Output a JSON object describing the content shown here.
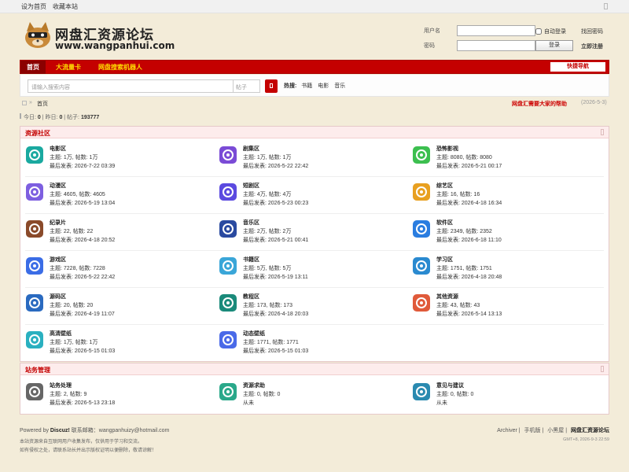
{
  "topbar": {
    "set_home": "设为首页",
    "bookmark": "收藏本站"
  },
  "logo": {
    "title": "网盘汇资源论坛",
    "url": "www.wangpanhui.com"
  },
  "login": {
    "username_label": "用户名",
    "password_label": "密码",
    "auto_login": "自动登录",
    "forgot": "找回密码",
    "login_btn": "登录",
    "register": "立即注册"
  },
  "nav": {
    "items": [
      "首页",
      "大流量卡",
      "网盘搜索机器人"
    ],
    "quick": "快捷导航"
  },
  "search": {
    "placeholder": "请输入搜索内容",
    "scope": "帖子",
    "hot_label": "热搜:",
    "hot": [
      "书籍",
      "电影",
      "音乐"
    ]
  },
  "crumb": {
    "here": "首页",
    "notice": "网盘汇需要大家的帮助",
    "date": "(2026-5-3)"
  },
  "stats": {
    "today_label": "今日:",
    "today": "0",
    "yesterday_label": "昨日:",
    "yesterday": "0",
    "posts_label": "帖子:",
    "posts": "193777"
  },
  "sections": [
    {
      "title": "资源社区",
      "forums": [
        {
          "name": "电影区",
          "stats": "主题: 1万, 帖数: 1万",
          "last": "最后发表: 2026-7-22 03:39",
          "icon": "film-reel-icon",
          "color": "#1aa9a0"
        },
        {
          "name": "剧集区",
          "stats": "主题: 1万, 帖数: 1万",
          "last": "最后发表: 2026-5-22 22:42",
          "icon": "tv-icon",
          "color": "#7a4bd6"
        },
        {
          "name": "恐怖影视",
          "stats": "主题: 8080, 帖数: 8080",
          "last": "最后发表: 2026-5-21 00:17",
          "icon": "ghost-icon",
          "color": "#3cbf4f"
        },
        {
          "name": "动漫区",
          "stats": "主题: 4605, 帖数: 4605",
          "last": "最后发表: 2026-5-19 13:04",
          "icon": "anime-icon",
          "color": "#7d5fe0"
        },
        {
          "name": "短剧区",
          "stats": "主题: 4万, 帖数: 4万",
          "last": "最后发表: 2026-5-23 00:23",
          "icon": "video-play-icon",
          "color": "#5b4ae0"
        },
        {
          "name": "综艺区",
          "stats": "主题: 16, 帖数: 16",
          "last": "最后发表: 2026-4-18 16:34",
          "icon": "variety-icon",
          "color": "#e8a020"
        },
        {
          "name": "纪录片",
          "stats": "主题: 22, 帖数: 22",
          "last": "最后发表: 2026-4-18 20:52",
          "icon": "camera-icon",
          "color": "#8a4a2a"
        },
        {
          "name": "音乐区",
          "stats": "主题: 2万, 帖数: 2万",
          "last": "最后发表: 2026-5-21 00:41",
          "icon": "headphones-icon",
          "color": "#2a4aa0"
        },
        {
          "name": "软件区",
          "stats": "主题: 2349, 帖数: 2352",
          "last": "最后发表: 2026-6-18 11:10",
          "icon": "software-icon",
          "color": "#2a7de0"
        },
        {
          "name": "游戏区",
          "stats": "主题: 7228, 帖数: 7228",
          "last": "最后发表: 2026-5-22 22:42",
          "icon": "gamepad-icon",
          "color": "#3b6de6"
        },
        {
          "name": "书籍区",
          "stats": "主题: 5万, 帖数: 5万",
          "last": "最后发表: 2026-5-19 13:11",
          "icon": "book-icon",
          "color": "#3aa6d8"
        },
        {
          "name": "学习区",
          "stats": "主题: 1751, 帖数: 1751",
          "last": "最后发表: 2026-4-18 20:48",
          "icon": "study-icon",
          "color": "#2a8ad0"
        },
        {
          "name": "源码区",
          "stats": "主题: 20, 帖数: 20",
          "last": "最后发表: 2026-4-19 11:07",
          "icon": "code-icon",
          "color": "#2a6ac0"
        },
        {
          "name": "教程区",
          "stats": "主题: 173, 帖数: 173",
          "last": "最后发表: 2026-4-18 20:03",
          "icon": "tutorial-icon",
          "color": "#1a8a7a"
        },
        {
          "name": "其他资源",
          "stats": "主题: 43, 帖数: 43",
          "last": "最后发表: 2026-5-14 13:13",
          "icon": "other-icon",
          "color": "#e05a3a"
        },
        {
          "name": "高清壁纸",
          "stats": "主题: 1万, 帖数: 1万",
          "last": "最后发表: 2026-5-15 01:03",
          "icon": "wallpaper-icon",
          "color": "#2ab0c0"
        },
        {
          "name": "动态壁纸",
          "stats": "主题: 1771, 帖数: 1771",
          "last": "最后发表: 2026-5-15 01:03",
          "icon": "live-wallpaper-icon",
          "color": "#4a6ae8"
        }
      ]
    },
    {
      "title": "站务管理",
      "forums": [
        {
          "name": "站务处理",
          "stats": "主题: 2, 帖数: 9",
          "last": "最后发表: 2026-5-13 23:18",
          "icon": "admin-icon",
          "color": "#666"
        },
        {
          "name": "资源求助",
          "stats": "主题: 0, 帖数: 0",
          "last": "从未",
          "icon": "help-icon",
          "color": "#2aa88a"
        },
        {
          "name": "意见与建议",
          "stats": "主题: 0, 帖数: 0",
          "last": "从未",
          "icon": "feedback-icon",
          "color": "#2a8ab0"
        }
      ]
    }
  ],
  "footer": {
    "powered": "Powered by",
    "discuz": "Discuz!",
    "contact": "联系邮箱：wangpanhuizy@hotmail.com",
    "note1": "本站资源来自互联网用户收集发布，仅供用于学习和交流。",
    "note2": "如有侵权之处，请联系站长并出示版权证明以便删除，敬请谅解！",
    "links": [
      "Archiver",
      "手机版",
      "小黑屋"
    ],
    "site": "网盘汇资源论坛",
    "time": "GMT+8, 2026-9-3 22:59"
  }
}
